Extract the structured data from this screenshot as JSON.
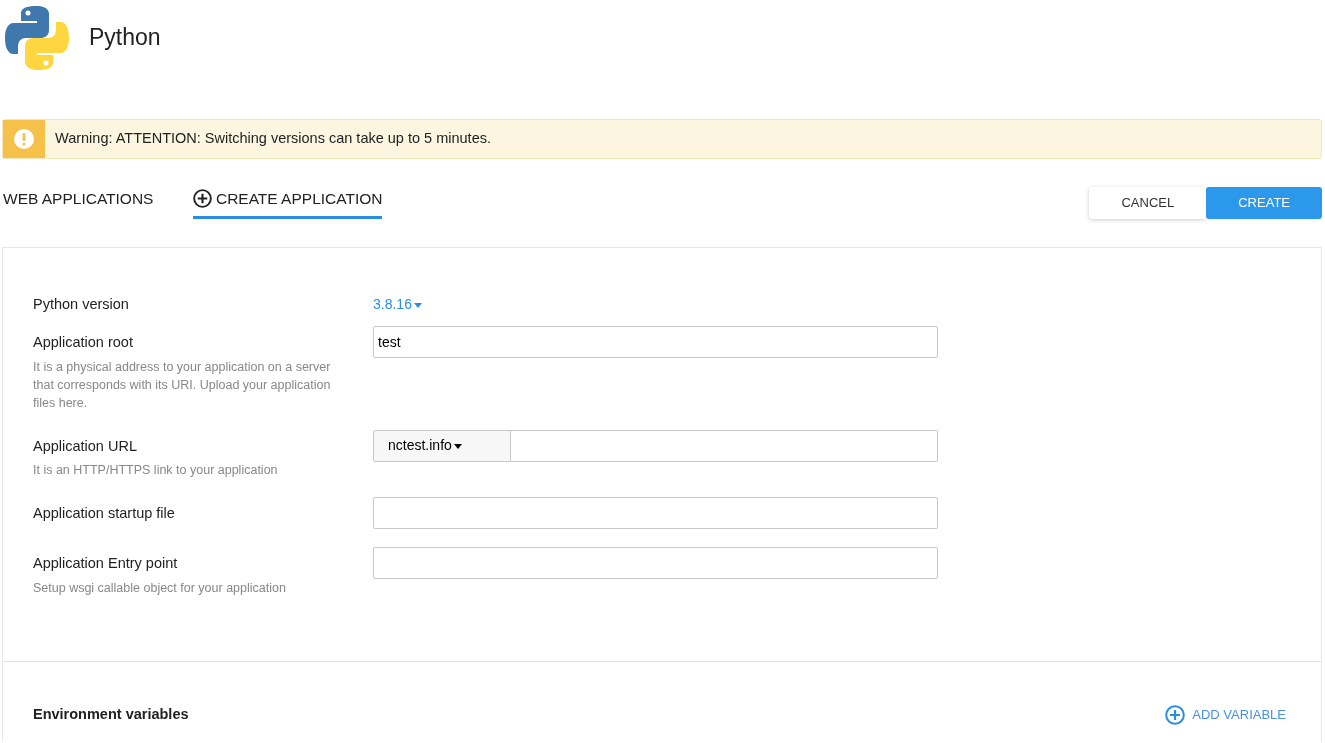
{
  "header": {
    "title": "Python"
  },
  "warning": {
    "text": "Warning: ATTENTION: Switching versions can take up to 5 minutes."
  },
  "tabs": [
    {
      "label": "WEB APPLICATIONS",
      "selected": false,
      "kind": "plain"
    },
    {
      "label": "CREATE APPLICATION",
      "selected": true,
      "kind": "add"
    }
  ],
  "actions": [
    {
      "label": "CANCEL",
      "kind": "secondary"
    },
    {
      "label": "CREATE",
      "kind": "primary"
    }
  ],
  "form": [
    {
      "kind": "select",
      "label": "Python version",
      "value": "3.8.16"
    },
    {
      "kind": "text",
      "label": "Application root",
      "value": "test",
      "help": "It is a physical address to your application on a server that corresponds with its URI. Upload your application files here."
    },
    {
      "kind": "url",
      "label": "Application URL",
      "domain": "nctest.info",
      "help": "It is an HTTP/HTTPS link to your application"
    },
    {
      "kind": "text",
      "label": "Application startup file"
    },
    {
      "kind": "text",
      "label": "Application Entry point",
      "help": "Setup wsgi callable object for your application"
    }
  ],
  "environment": {
    "title": "Environment variables",
    "add_label": "ADD VARIABLE"
  }
}
